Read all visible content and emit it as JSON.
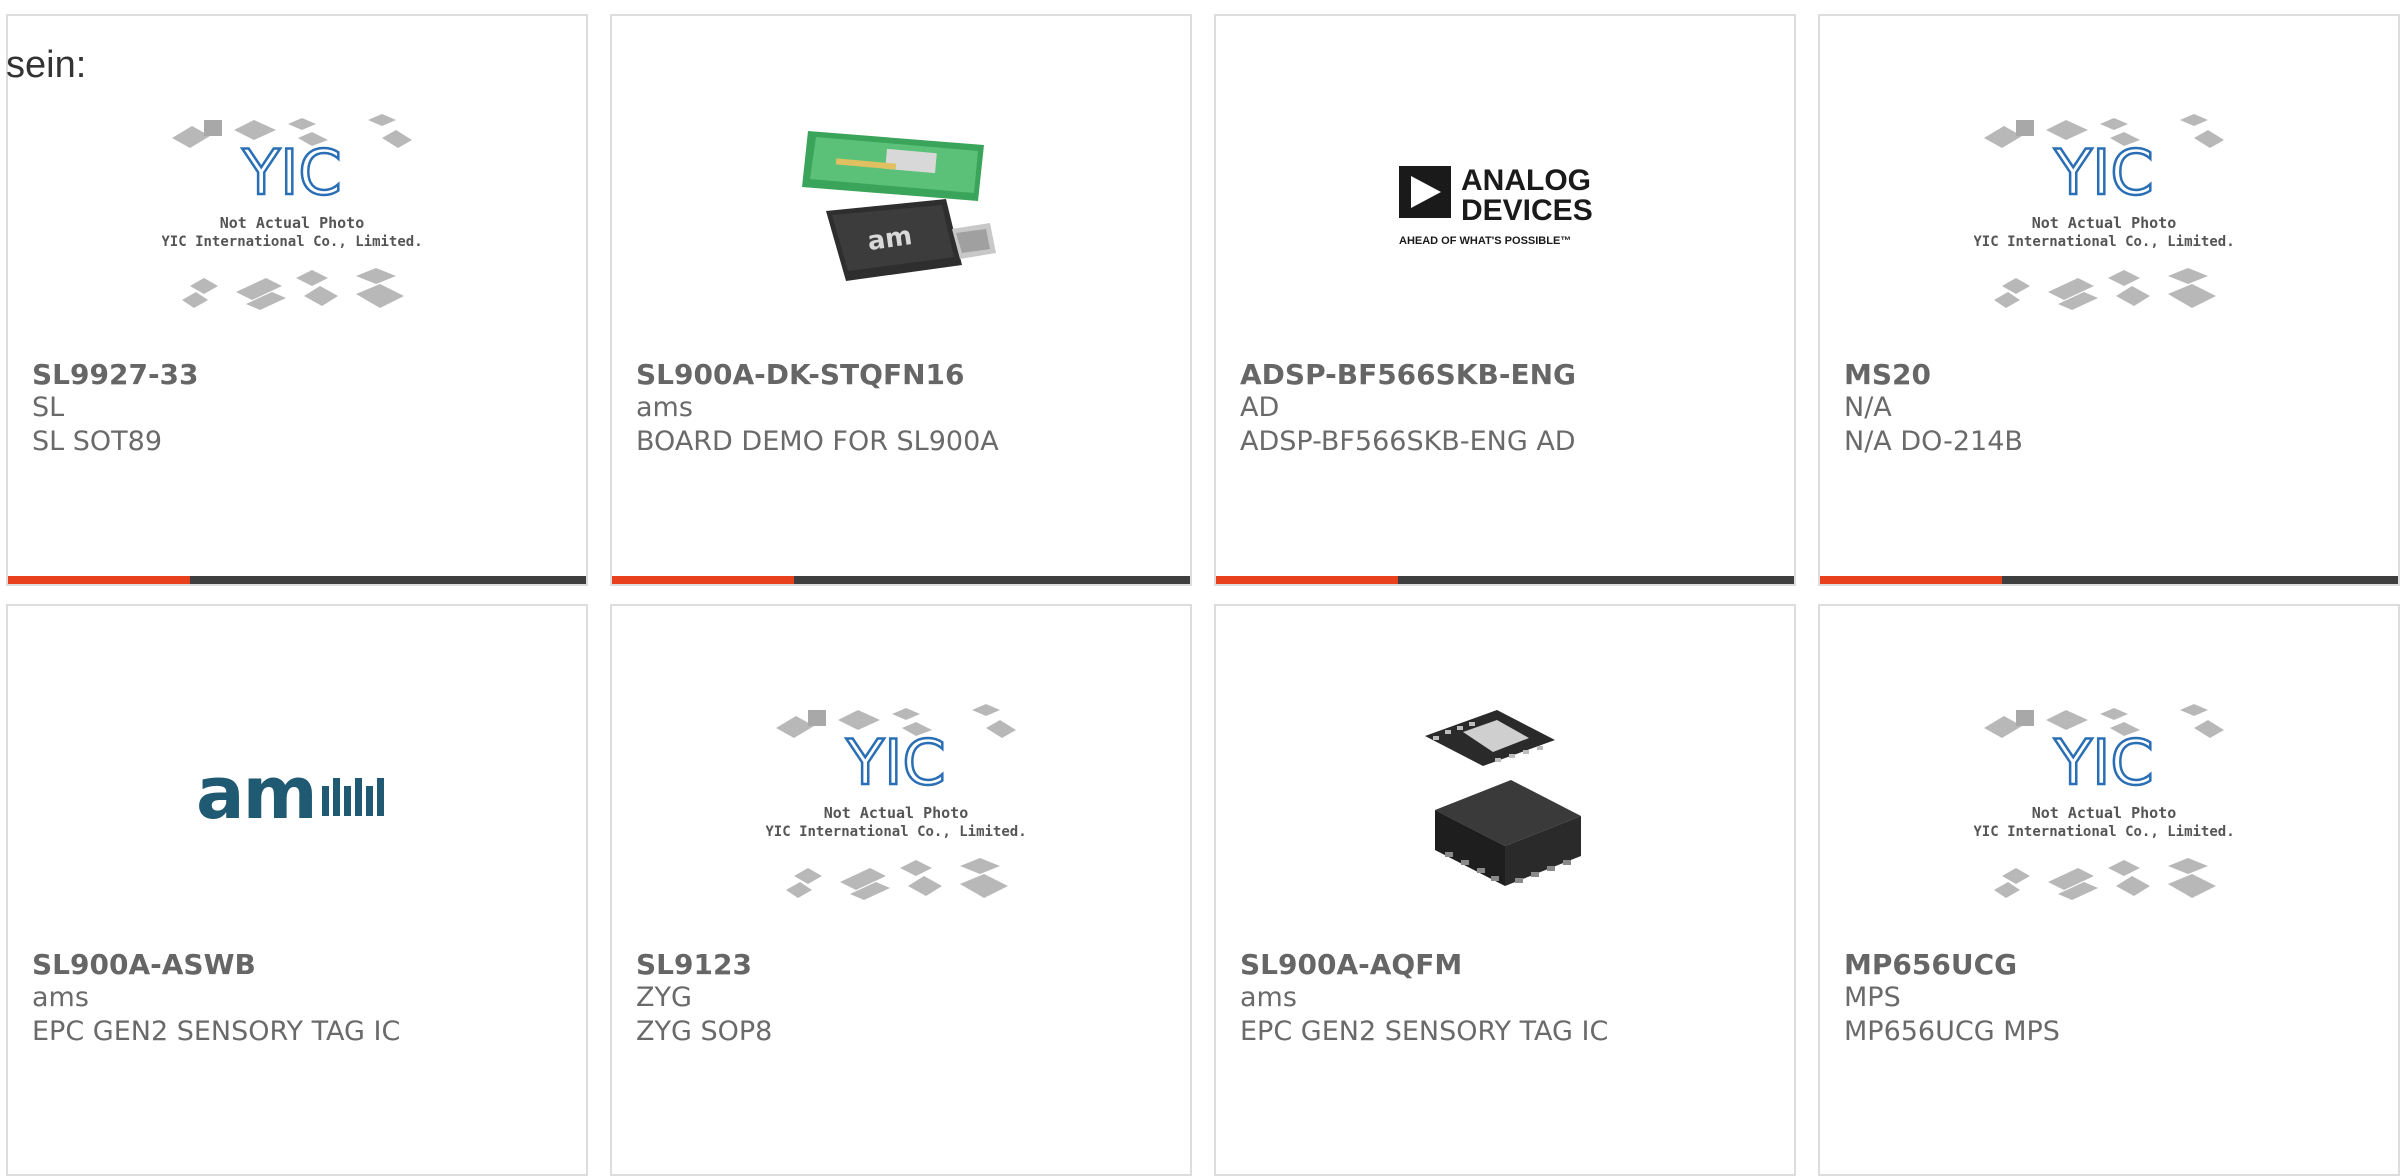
{
  "header": {
    "partial_label": "sein:"
  },
  "placeholder_photo": {
    "brand": "YIC",
    "line1": "Not Actual Photo",
    "line2": "YIC International Co., Limited."
  },
  "logos": {
    "analog_devices": {
      "line1": "ANALOG",
      "line2": "DEVICES",
      "tagline": "AHEAD OF WHAT'S POSSIBLE™"
    },
    "ams": "am"
  },
  "colors": {
    "accent": "#e8401c",
    "bar": "#3e3e3e",
    "text": "#6a6a6a",
    "ams_blue": "#1f5a72"
  },
  "products": [
    {
      "part_number": "SL9927-33",
      "manufacturer": "SL",
      "description": "SL SOT89",
      "image": "placeholder"
    },
    {
      "part_number": "SL900A-DK-STQFN16",
      "manufacturer": "ams",
      "description": "BOARD DEMO FOR SL900A",
      "image": "usb-demo-board"
    },
    {
      "part_number": "ADSP-BF566SKB-ENG",
      "manufacturer": "AD",
      "description": "ADSP-BF566SKB-ENG AD",
      "image": "analog-devices-logo"
    },
    {
      "part_number": "MS20",
      "manufacturer": "N/A",
      "description": "N/A DO-214B",
      "image": "placeholder"
    },
    {
      "part_number": "SL900A-ASWB",
      "manufacturer": "ams",
      "description": "EPC GEN2 SENSORY TAG IC",
      "image": "ams-logo"
    },
    {
      "part_number": "SL9123",
      "manufacturer": "ZYG",
      "description": "ZYG SOP8",
      "image": "placeholder"
    },
    {
      "part_number": "SL900A-AQFM",
      "manufacturer": "ams",
      "description": "EPC GEN2 SENSORY TAG IC",
      "image": "qfn-chip"
    },
    {
      "part_number": "MP656UCG",
      "manufacturer": "MPS",
      "description": "MP656UCG MPS",
      "image": "placeholder"
    }
  ]
}
